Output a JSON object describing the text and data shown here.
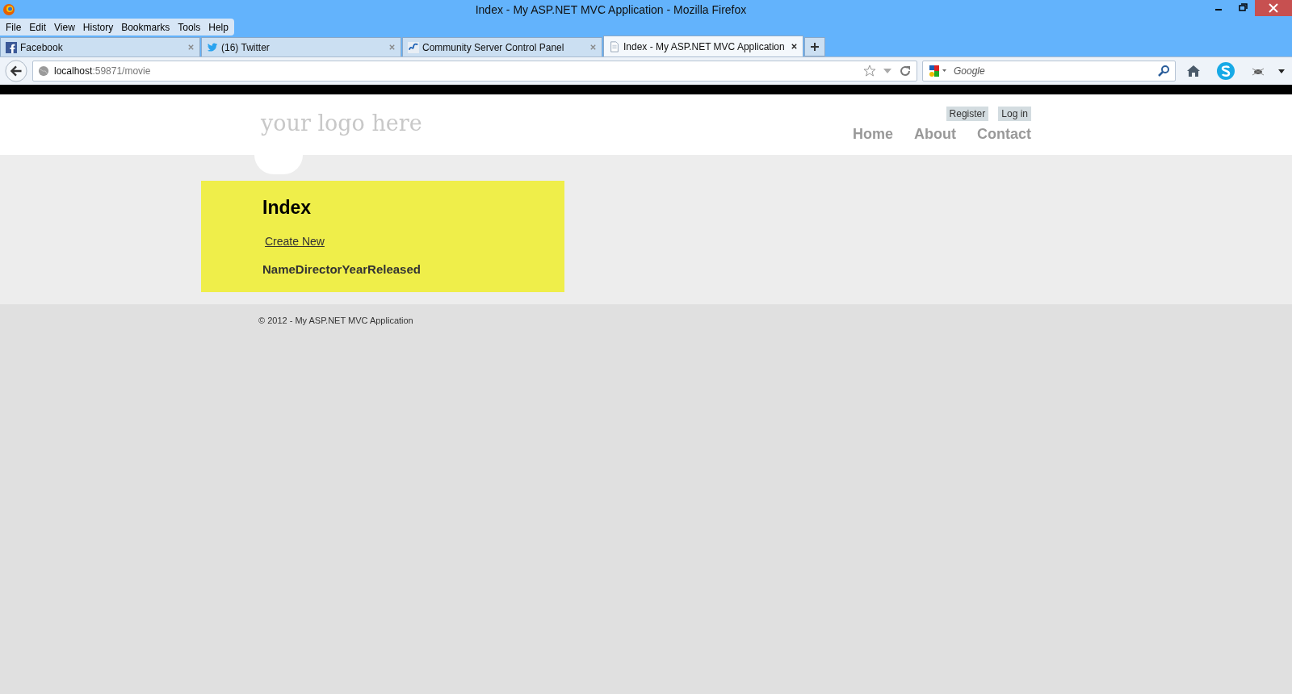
{
  "window": {
    "title": "Index - My ASP.NET MVC Application - Mozilla Firefox"
  },
  "menu": [
    "File",
    "Edit",
    "View",
    "History",
    "Bookmarks",
    "Tools",
    "Help"
  ],
  "tabs": [
    {
      "label": "Facebook",
      "kind": "facebook",
      "selected": false
    },
    {
      "label": "(16) Twitter",
      "kind": "twitter",
      "selected": false
    },
    {
      "label": "Community Server Control Panel",
      "kind": "community",
      "selected": false
    },
    {
      "label": "Index - My ASP.NET MVC Application",
      "kind": "page",
      "selected": true
    }
  ],
  "address": {
    "host": "localhost",
    "rest": ":59871/movie"
  },
  "search": {
    "placeholder": "Google"
  },
  "site": {
    "logo": "your logo here",
    "account_links": [
      "Register",
      "Log in"
    ],
    "nav": [
      "Home",
      "About",
      "Contact"
    ],
    "heading": "Index",
    "create_link": "Create New",
    "columns": [
      "Name",
      "Director",
      "YearReleased"
    ],
    "footer": "© 2012 - My ASP.NET MVC Application"
  }
}
